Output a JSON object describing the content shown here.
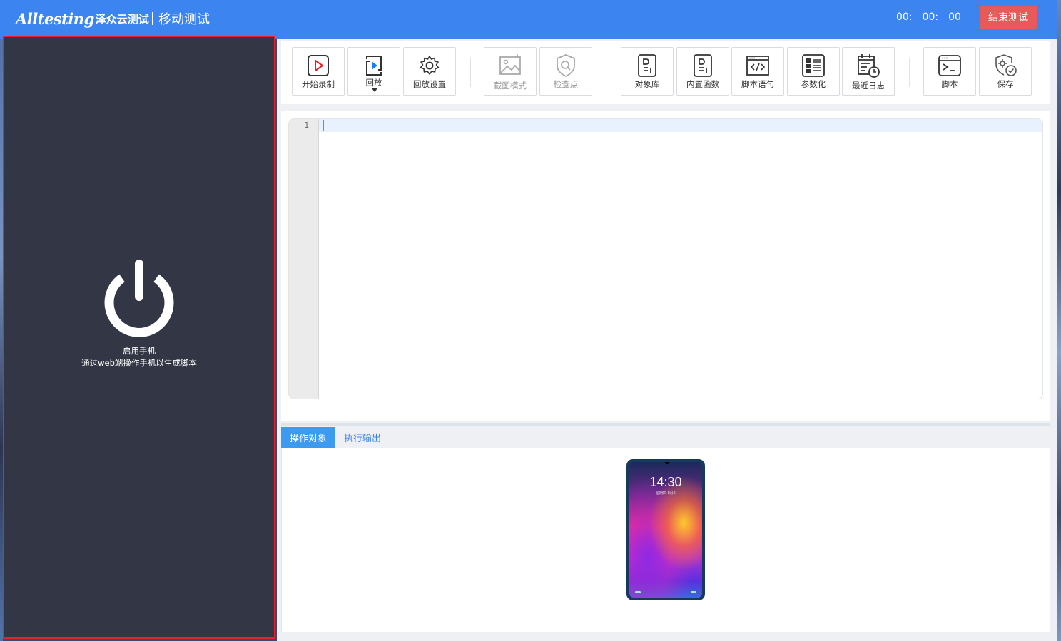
{
  "header": {
    "logo_word": "Alltesting",
    "logo_cn": "泽众云测试",
    "module_title": "移动测试",
    "timer": {
      "hours": "00:",
      "minutes": "00:",
      "seconds": "00"
    },
    "end_button": "结束测试"
  },
  "phone_panel": {
    "caption_line1": "启用手机",
    "caption_line2": "通过web端操作手机以生成脚本"
  },
  "toolbar": {
    "start_record": "开始录制",
    "playback": "回放",
    "playback_settings": "回放设置",
    "screenshot_mode": "截图模式",
    "checkpoint": "检查点",
    "object_library": "对象库",
    "builtin_functions": "内置函数",
    "script_statements": "脚本语句",
    "parameterize": "参数化",
    "recent_logs": "最近日志",
    "script": "脚本",
    "save": "保存"
  },
  "editor": {
    "line_numbers": [
      "1"
    ]
  },
  "bottom_tabs": {
    "operation_objects": "操作对象",
    "execution_output": "执行输出"
  },
  "device": {
    "time": "14:30",
    "date": "星期四 8月5"
  },
  "colors": {
    "header_bg": "#3c84f0",
    "end_button_bg": "#e85a5a",
    "phone_panel_bg": "#333645",
    "selection_border": "#e8212c",
    "active_tab_bg": "#3c9af0"
  }
}
